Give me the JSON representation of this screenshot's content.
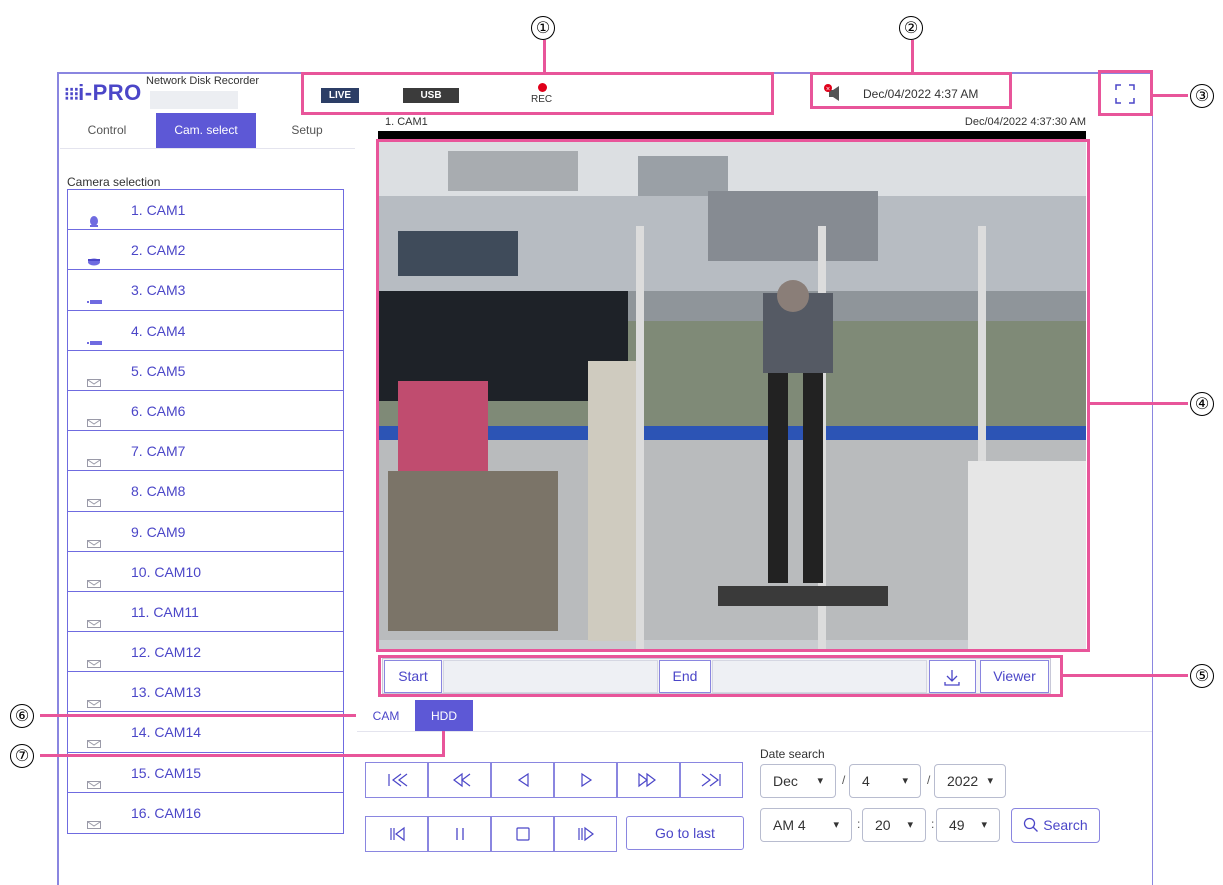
{
  "callouts": [
    "①",
    "②",
    "③",
    "④",
    "⑤",
    "⑥",
    "⑦"
  ],
  "header": {
    "logo": "i-PRO",
    "logo_dots": "⁝⁝⁝",
    "product_name": "Network Disk Recorder",
    "status": {
      "live": "LIVE",
      "usb": "USB",
      "rec": "REC"
    },
    "datetime": "Dec/04/2022 4:37 AM"
  },
  "left_tabs": [
    "Control",
    "Cam. select",
    "Setup"
  ],
  "camera_selection": {
    "label": "Camera selection",
    "cameras": [
      {
        "name": "1. CAM1",
        "icon": "dome-camera-icon"
      },
      {
        "name": "2. CAM2",
        "icon": "fisheye-camera-icon"
      },
      {
        "name": "3. CAM3",
        "icon": "box-camera-icon"
      },
      {
        "name": "4. CAM4",
        "icon": "box-camera-icon"
      },
      {
        "name": "5. CAM5",
        "icon": "camera-placeholder-icon"
      },
      {
        "name": "6. CAM6",
        "icon": "camera-placeholder-icon"
      },
      {
        "name": "7. CAM7",
        "icon": "camera-placeholder-icon"
      },
      {
        "name": "8. CAM8",
        "icon": "camera-placeholder-icon"
      },
      {
        "name": "9. CAM9",
        "icon": "camera-placeholder-icon"
      },
      {
        "name": "10. CAM10",
        "icon": "camera-placeholder-icon"
      },
      {
        "name": "11. CAM11",
        "icon": "camera-placeholder-icon"
      },
      {
        "name": "12. CAM12",
        "icon": "camera-placeholder-icon"
      },
      {
        "name": "13. CAM13",
        "icon": "camera-placeholder-icon"
      },
      {
        "name": "14. CAM14",
        "icon": "camera-placeholder-icon"
      },
      {
        "name": "15. CAM15",
        "icon": "camera-placeholder-icon"
      },
      {
        "name": "16. CAM16",
        "icon": "camera-placeholder-icon"
      }
    ]
  },
  "video": {
    "channel": "1. CAM1",
    "timestamp": "Dec/04/2022 4:37:30 AM"
  },
  "clip_bar": {
    "start": "Start",
    "end": "End",
    "viewer": "Viewer",
    "start_value": "",
    "end_value": ""
  },
  "source_tabs": {
    "cam": "CAM",
    "hdd": "HDD"
  },
  "date_search": {
    "label": "Date search",
    "month": "Dec",
    "day": "4",
    "year": "2022",
    "hour": "AM 4",
    "minute": "20",
    "second": "49",
    "search": "Search",
    "slash": "/",
    "colon": ":"
  },
  "playback": {
    "go_to_last": "Go to last"
  },
  "colors": {
    "accent": "#5d58d6",
    "callout": "#e8559a",
    "rec": "#e0001a",
    "live_badge": "#2c3e66",
    "usb_badge": "#3b3b3b"
  }
}
